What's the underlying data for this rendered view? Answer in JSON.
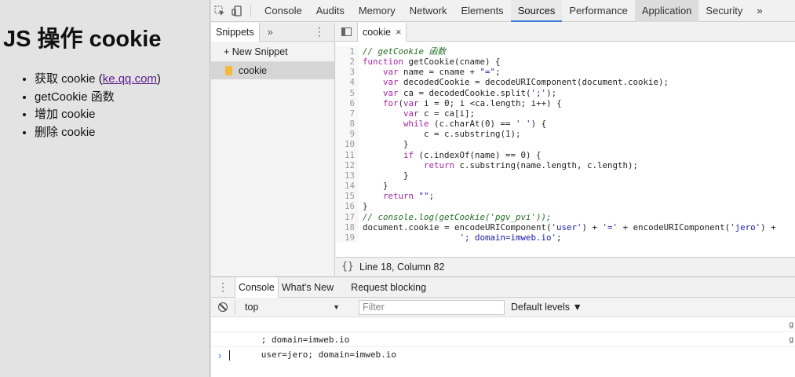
{
  "page": {
    "title": "JS 操作 cookie",
    "items": [
      {
        "text": "获取 cookie (",
        "link": "ke.qq.com",
        "after": ")"
      },
      {
        "text": "getCookie 函数"
      },
      {
        "text": "增加 cookie"
      },
      {
        "text": "删除 cookie"
      }
    ]
  },
  "devtools": {
    "tabs": [
      "Console",
      "Audits",
      "Memory",
      "Network",
      "Elements",
      "Sources",
      "Performance",
      "Application",
      "Security"
    ],
    "active_tab": "Sources",
    "more": "»",
    "navigator": {
      "tab": "Snippets",
      "more": "»",
      "kebab": "⋮",
      "new_snippet": "+ New Snippet",
      "snippet": "cookie"
    },
    "editor": {
      "file_tab": "cookie",
      "close": "×",
      "lines": [
        "// getCookie 函数",
        "function getCookie(cname) {",
        "    var name = cname + \"=\";",
        "    var decodedCookie = decodeURIComponent(document.cookie);",
        "    var ca = decodedCookie.split(';');",
        "    for(var i = 0; i <ca.length; i++) {",
        "        var c = ca[i];",
        "        while (c.charAt(0) == ' ') {",
        "            c = c.substring(1);",
        "        }",
        "        if (c.indexOf(name) == 0) {",
        "            return c.substring(name.length, c.length);",
        "        }",
        "    }",
        "    return \"\";",
        "}",
        "// console.log(getCookie('pgv_pvi'));",
        "document.cookie = encodeURIComponent('user') + '=' + encodeURIComponent('jero') +",
        "                   '; domain=imweb.io';"
      ],
      "status": "Line 18, Column 82",
      "status_icon": "{}"
    },
    "drawer": {
      "kebab": "⋮",
      "tabs": [
        "Console",
        "What's New",
        "Request blocking"
      ],
      "active_tab": "Console",
      "context": "top",
      "context_arrow": "▼",
      "filter_placeholder": "Filter",
      "levels": "Default levels ▼",
      "logs": [
        {
          "text": "; domain=imweb.io",
          "src": "g"
        },
        {
          "text": "user=jero; domain=imweb.io",
          "src": "g"
        }
      ],
      "prompt": "›"
    }
  }
}
